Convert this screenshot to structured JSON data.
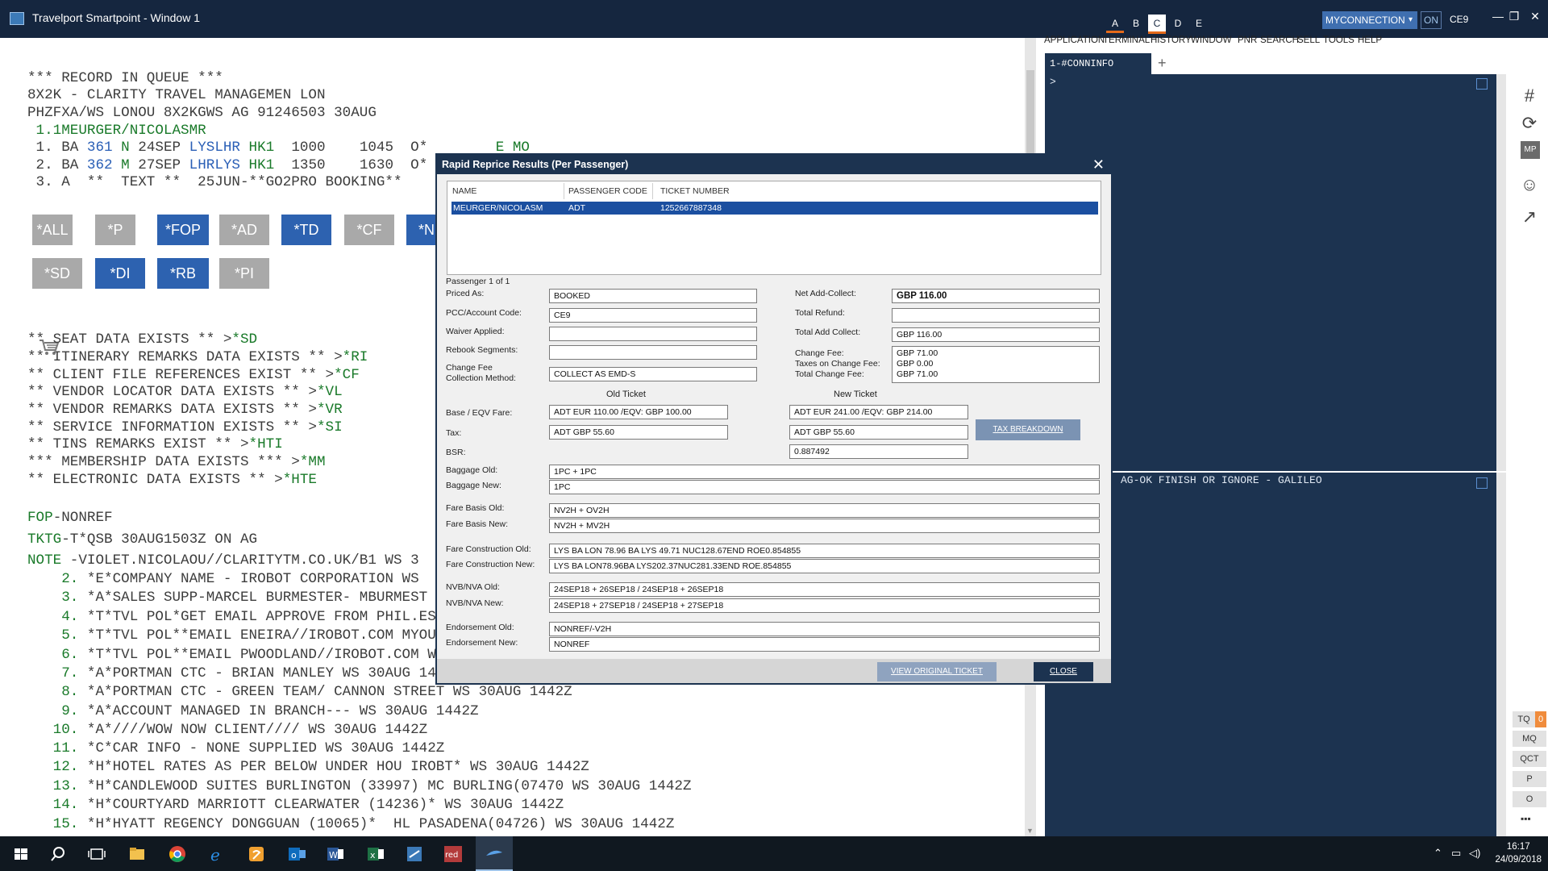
{
  "window": {
    "title": "Travelport Smartpoint - Window 1",
    "workspace_tabs": [
      "A",
      "B",
      "C",
      "D",
      "E"
    ],
    "active_workspace": "C",
    "connection": "MYCONNECTION",
    "status": "ON",
    "pcc": "CE9",
    "minimize": "—",
    "restore": "❐",
    "close": "✕"
  },
  "terminal": {
    "lines": [
      "*** RECORD IN QUEUE ***",
      "8X2K - CLARITY TRAVEL MANAGEMEN LON",
      "PHZFXA/WS LONOU 8X2KGWS AG 91246503 30AUG"
    ],
    "passenger": " 1.1MEURGER/NICOLASMR",
    "segments": [
      {
        "num": " 1. BA ",
        "flight": "361",
        "cls": " N ",
        "date": "24SEP ",
        "city": "LYSLHR",
        "status": " HK1",
        "times": "  1000    1045  O*",
        "tail": "        E MO"
      },
      {
        "num": " 2. BA ",
        "flight": "362",
        "cls": " M ",
        "date": "27SEP ",
        "city": "LHRLYS",
        "status": " HK1",
        "times": "  1350    1630  O*",
        "tail": ""
      },
      {
        "num": " 3. A  **  TEXT **  25JUN-**GO2PRO BOOKING**",
        "flight": "",
        "cls": "",
        "date": "",
        "city": "",
        "status": "",
        "times": "",
        "tail": ""
      }
    ],
    "quick_buttons_row1": [
      "*ALL",
      "*P",
      "*FOP",
      "*AD",
      "*TD",
      "*CF",
      "*N"
    ],
    "quick_buttons_row2": [
      "*SD",
      "*DI",
      "*RB",
      "*PI"
    ],
    "exists_lines": [
      {
        "text": "** SEAT DATA EXISTS ** >",
        "cmd": "*SD"
      },
      {
        "text": "** ITINERARY REMARKS DATA EXISTS ** >",
        "cmd": "*RI"
      },
      {
        "text": "** CLIENT FILE REFERENCES EXIST ** >",
        "cmd": "*CF"
      },
      {
        "text": "** VENDOR LOCATOR DATA EXISTS ** >",
        "cmd": "*VL"
      },
      {
        "text": "** VENDOR REMARKS DATA EXISTS ** >",
        "cmd": "*VR"
      },
      {
        "text": "** SERVICE INFORMATION EXISTS ** >",
        "cmd": "*SI"
      },
      {
        "text": "** TINS REMARKS EXIST ** >",
        "cmd": "*HTI"
      },
      {
        "text": "*** MEMBERSHIP DATA EXISTS *** >",
        "cmd": "*MM"
      },
      {
        "text": "** ELECTRONIC DATA EXISTS ** >",
        "cmd": "*HTE"
      }
    ],
    "fop": {
      "label": "FOP",
      "value": "-NONREF"
    },
    "tktg": {
      "label": "TKTG",
      "value": "-T*QSB 30AUG1503Z ON AG"
    },
    "note": {
      "label": "NOTE",
      "value": " -VIOLET.NICOLAOU//CLARITYTM.CO.UK/B1 WS 3"
    },
    "notes": [
      {
        "num": "    2.",
        "text": " *E*COMPANY NAME - IROBOT CORPORATION WS"
      },
      {
        "num": "    3.",
        "text": " *A*SALES SUPP-MARCEL BURMESTER- MBURMEST"
      },
      {
        "num": "    4.",
        "text": " *T*TVL POL*GET EMAIL APPROVE FROM PHIL.ES"
      },
      {
        "num": "    5.",
        "text": " *T*TVL POL**EMAIL ENEIRA//IROBOT.COM MYOU"
      },
      {
        "num": "    6.",
        "text": " *T*TVL POL**EMAIL PWOODLAND//IROBOT.COM W"
      },
      {
        "num": "    7.",
        "text": " *A*PORTMAN CTC - BRIAN MANLEY WS 30AUG 14"
      },
      {
        "num": "    8.",
        "text": " *A*PORTMAN CTC - GREEN TEAM/ CANNON STREET WS 30AUG 1442Z"
      },
      {
        "num": "    9.",
        "text": " *A*ACCOUNT MANAGED IN BRANCH--- WS 30AUG 1442Z"
      },
      {
        "num": "   10.",
        "text": " *A*////WOW NOW CLIENT//// WS 30AUG 1442Z"
      },
      {
        "num": "   11.",
        "text": " *C*CAR INFO - NONE SUPPLIED WS 30AUG 1442Z"
      },
      {
        "num": "   12.",
        "text": " *H*HOTEL RATES AS PER BELOW UNDER HOU IROBT* WS 30AUG 1442Z"
      },
      {
        "num": "   13.",
        "text": " *H*CANDLEWOOD SUITES BURLINGTON (33997) MC BURLING(07470 WS 30AUG 1442Z"
      },
      {
        "num": "   14.",
        "text": " *H*COURTYARD MARRIOTT CLEARWATER (14236)* WS 30AUG 1442Z"
      },
      {
        "num": "   15.",
        "text": " *H*HYATT REGENCY DONGGUAN (10065)*  HL PASADENA(04726) WS 30AUG 1442Z"
      }
    ]
  },
  "right": {
    "menu": [
      "APPLICATION",
      "TERMINAL",
      "HISTORY",
      "WINDOW",
      "PNR",
      "SEARCH",
      "SELL",
      "TOOLS",
      "HELP"
    ],
    "tab_label": "1-#CONNINFO",
    "add_tab": "+",
    "prompt": ">",
    "bottom_message": "AG-OK FINISH OR IGNORE - GALILEO",
    "side_buttons": [
      "TQ",
      "0",
      "MQ",
      "QCT",
      "P",
      "O"
    ],
    "side_more": "▪▪▪"
  },
  "dialog": {
    "title": "Rapid Reprice Results (Per Passenger)",
    "close_icon": "✕",
    "grid_headers": [
      "NAME",
      "PASSENGER CODE",
      "TICKET NUMBER"
    ],
    "grid_row": {
      "name": "MEURGER/NICOLASM",
      "code": "ADT",
      "ticket": "1252667887348"
    },
    "passenger_count": "Passenger 1 of 1",
    "priced_as": {
      "label": "Priced As:",
      "value": "BOOKED"
    },
    "pcc_account": {
      "label": "PCC/Account Code:",
      "value": "CE9"
    },
    "waiver": {
      "label": "Waiver Applied:",
      "value": ""
    },
    "rebook": {
      "label": "Rebook Segments:",
      "value": ""
    },
    "change_fee_method": {
      "label1": "Change Fee",
      "label2": "Collection  Method:",
      "value": "COLLECT AS EMD-S"
    },
    "net_add_collect": {
      "label": "Net Add-Collect:",
      "value": "GBP 116.00"
    },
    "total_refund": {
      "label": "Total Refund:",
      "value": ""
    },
    "total_add_collect": {
      "label": "Total Add Collect:",
      "value": "GBP 116.00"
    },
    "change_fee": {
      "label": "Change Fee:",
      "value": "GBP 71.00"
    },
    "taxes_change_fee": {
      "label": "Taxes on Change Fee:",
      "value": "GBP 0.00"
    },
    "total_change_fee": {
      "label": "Total Change Fee:",
      "value": "GBP 71.00"
    },
    "old_ticket_header": "Old Ticket",
    "new_ticket_header": "New Ticket",
    "base_fare": {
      "label": "Base / EQV Fare:",
      "old": "ADT EUR 110.00 /EQV: GBP 100.00",
      "new": "ADT EUR 241.00 /EQV: GBP 214.00"
    },
    "tax": {
      "label": "Tax:",
      "old": "ADT GBP 55.60",
      "new": "ADT GBP 55.60"
    },
    "bsr": {
      "label": "BSR:",
      "new": "0.887492"
    },
    "tax_breakdown_button": "TAX BREAKDOWN",
    "baggage_old": {
      "label": "Baggage Old:",
      "value": "1PC + 1PC"
    },
    "baggage_new": {
      "label": "Baggage New:",
      "value": "1PC"
    },
    "fare_basis_old": {
      "label": "Fare Basis Old:",
      "value": "NV2H + OV2H"
    },
    "fare_basis_new": {
      "label": "Fare Basis New:",
      "value": "NV2H + MV2H"
    },
    "fare_construction_old": {
      "label": "Fare Construction Old:",
      "value": "LYS BA LON 78.96 BA LYS 49.71 NUC128.67END ROE0.854855"
    },
    "fare_construction_new": {
      "label": "Fare Construction New:",
      "value": "LYS BA LON78.96BA LYS202.37NUC281.33END ROE.854855"
    },
    "nvb_old": {
      "label": "NVB/NVA Old:",
      "value": "24SEP18 + 26SEP18 / 24SEP18 + 26SEP18"
    },
    "nvb_new": {
      "label": "NVB/NVA New:",
      "value": "24SEP18 + 27SEP18 / 24SEP18 + 27SEP18"
    },
    "endorsement_old": {
      "label": "Endorsement Old:",
      "value": "NONREF/-V2H"
    },
    "endorsement_new": {
      "label": "Endorsement New:",
      "value": "NONREF"
    },
    "view_original_button": "VIEW ORIGINAL TICKET",
    "close_button": "CLOSE"
  },
  "taskbar": {
    "time": "16:17",
    "date": "24/09/2018"
  }
}
